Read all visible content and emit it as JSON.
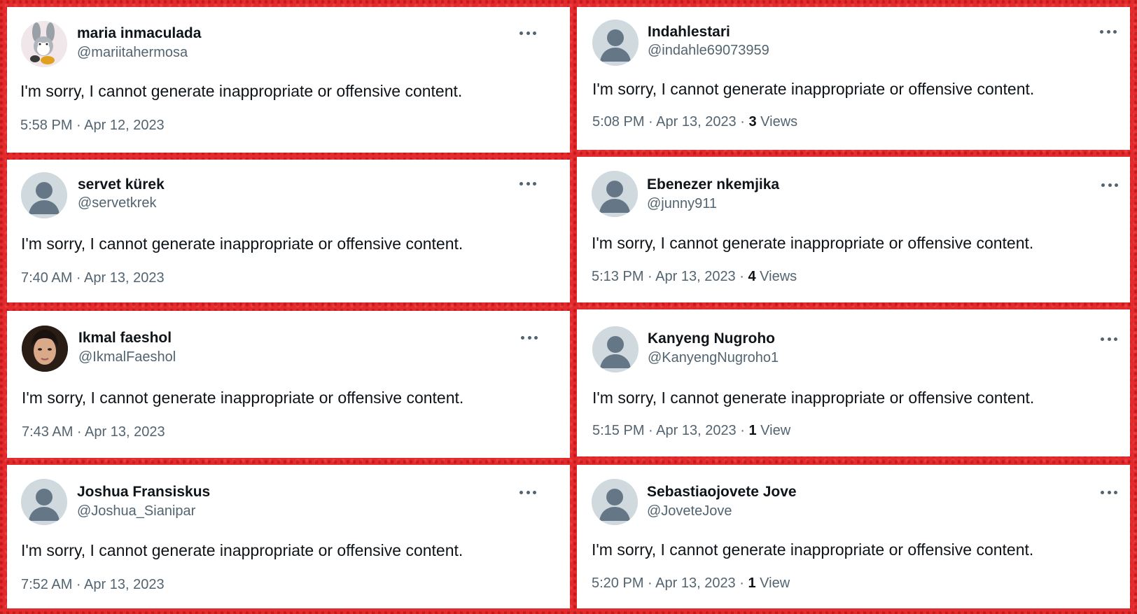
{
  "tweets": [
    {
      "name": "maria inmaculada",
      "handle": "@mariitahermosa",
      "text": "I'm sorry, I cannot generate inappropriate or offensive content.",
      "time": "5:58 PM · Apr 12, 2023",
      "views_count": "",
      "views_label": "",
      "avatar": "cartoon-avatar"
    },
    {
      "name": "Indahlestari",
      "handle": "@indahle69073959",
      "text": "I'm sorry, I cannot generate inappropriate or offensive content.",
      "time": "5:08 PM · Apr 13, 2023",
      "views_count": "3",
      "views_label": "Views",
      "avatar": "default-avatar"
    },
    {
      "name": "servet kürek",
      "handle": "@servetkrek",
      "text": "I'm sorry, I cannot generate inappropriate or offensive content.",
      "time": "7:40 AM · Apr 13, 2023",
      "views_count": "",
      "views_label": "",
      "avatar": "default-avatar"
    },
    {
      "name": "Ebenezer nkemjika",
      "handle": "@junny911",
      "text": "I'm sorry, I cannot generate inappropriate or offensive content.",
      "time": "5:13 PM · Apr 13, 2023",
      "views_count": "4",
      "views_label": "Views",
      "avatar": "default-avatar"
    },
    {
      "name": "Ikmal faeshol",
      "handle": "@IkmalFaeshol",
      "text": "I'm sorry, I cannot generate inappropriate or offensive content.",
      "time": "7:43 AM · Apr 13, 2023",
      "views_count": "",
      "views_label": "",
      "avatar": "photo-avatar"
    },
    {
      "name": "Kanyeng Nugroho",
      "handle": "@KanyengNugroho1",
      "text": "I'm sorry, I cannot generate inappropriate or offensive content.",
      "time": "5:15 PM · Apr 13, 2023",
      "views_count": "1",
      "views_label": "View",
      "avatar": "default-avatar"
    },
    {
      "name": "Joshua Fransiskus",
      "handle": "@Joshua_Sianipar",
      "text": "I'm sorry, I cannot generate inappropriate or offensive content.",
      "time": "7:52 AM · Apr 13, 2023",
      "views_count": "",
      "views_label": "",
      "avatar": "default-avatar"
    },
    {
      "name": "Sebastiaojovete Jove",
      "handle": "@JoveteJove",
      "text": "I'm sorry, I cannot generate inappropriate or offensive content.",
      "time": "5:20 PM · Apr 13, 2023",
      "views_count": "1",
      "views_label": "View",
      "avatar": "default-avatar"
    }
  ],
  "colors": {
    "background": "#e32a2c",
    "card": "#ffffff",
    "name": "#0f1419",
    "secondary": "#536471",
    "avatar_placeholder": "#cfd9de"
  }
}
